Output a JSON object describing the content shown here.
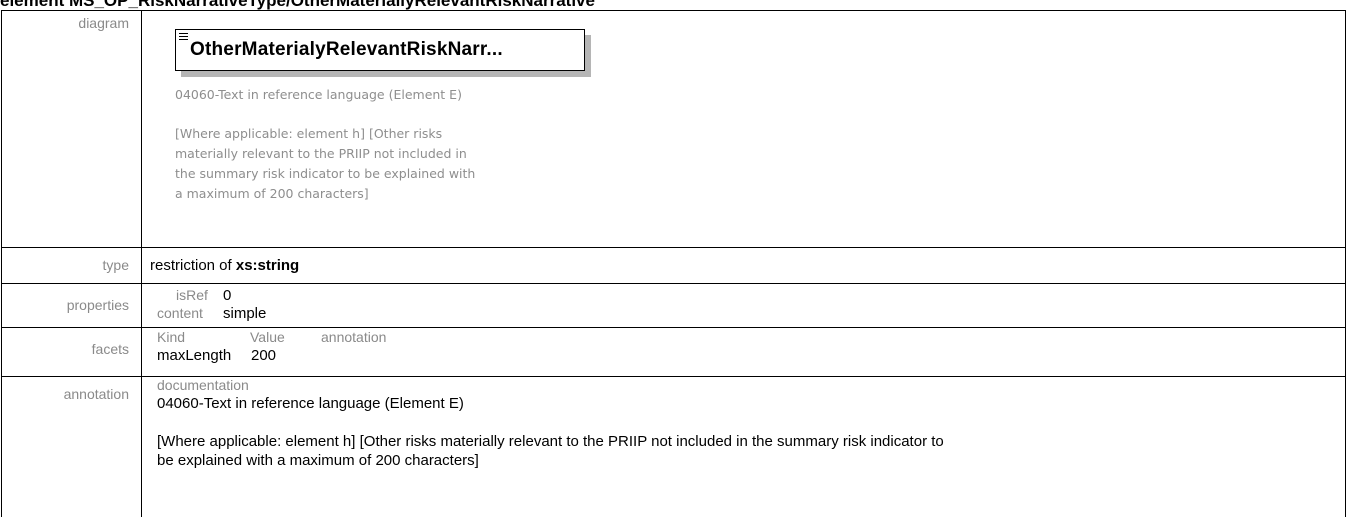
{
  "heading": "element MS_OP_RiskNarrativeType/OtherMateriallyRelevantRiskNarrative",
  "rows": {
    "diagram": {
      "label": "diagram",
      "element_name": "OtherMaterialyRelevantRiskNarr...",
      "note_line1": "04060-Text in reference language (Element E)",
      "note_lines": [
        "[Where applicable: element h] [Other risks",
        "materially relevant to the PRIIP not included in",
        "the summary risk indicator to be explained with",
        "a maximum of 200 characters]"
      ]
    },
    "type": {
      "label": "type",
      "prefix": "restriction of ",
      "base": "xs:string"
    },
    "properties": {
      "label": "properties",
      "items": [
        {
          "key": "isRef",
          "value": "0"
        },
        {
          "key": "content",
          "value": "simple"
        }
      ]
    },
    "facets": {
      "label": "facets",
      "headers": [
        "Kind",
        "Value",
        "annotation"
      ],
      "row": {
        "kind": "maxLength",
        "value": "200",
        "annotation": ""
      }
    },
    "annotation": {
      "label": "annotation",
      "doc_label": "documentation",
      "line1": "04060-Text in reference language (Element E)",
      "line2": "[Where applicable: element h] [Other risks materially relevant to the PRIIP not included in the summary risk indicator to",
      "line3": "be explained with a maximum of 200 characters]"
    }
  }
}
